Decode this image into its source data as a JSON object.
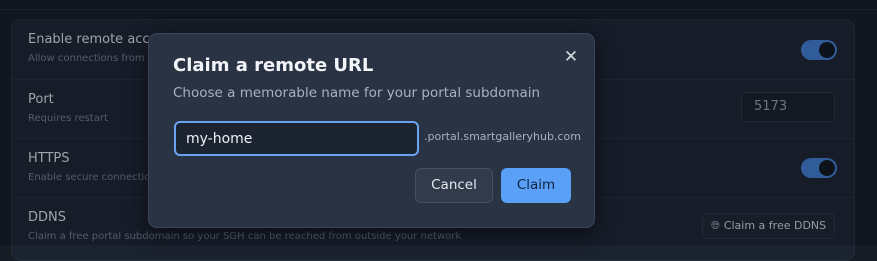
{
  "settings": {
    "rows": [
      {
        "title": "Enable remote access",
        "subtitle": "Allow connections from outside your network",
        "toggle_on": true
      },
      {
        "title": "Port",
        "subtitle": "Requires restart",
        "value": "5173"
      },
      {
        "title": "HTTPS",
        "subtitle": "Enable secure connections",
        "toggle_on": true
      },
      {
        "title": "DDNS",
        "subtitle": "Claim a free portal subdomain so your SGH can be reached from outside your network",
        "button_label": "Claim a free DDNS",
        "button_icon": "globe-icon"
      }
    ]
  },
  "modal": {
    "title": "Claim a remote URL",
    "subtitle": "Choose a memorable name for your portal subdomain",
    "input_value": "my-home",
    "domain_suffix": ".portal.smartgalleryhub.com",
    "cancel_label": "Cancel",
    "claim_label": "Claim",
    "close_icon": "close-icon"
  },
  "colors": {
    "accent": "#5aa0f7",
    "toggle_on": "#3f77c9",
    "modal_bg": "#2a3343",
    "page_bg": "#161b24"
  }
}
